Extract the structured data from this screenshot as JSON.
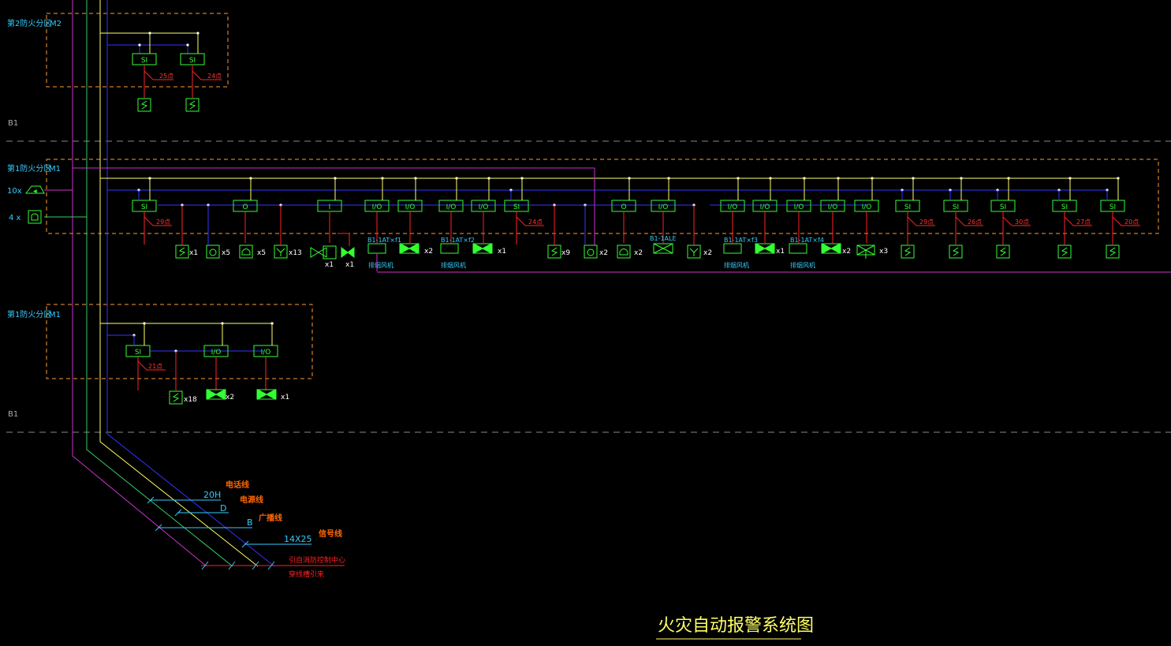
{
  "title": "火灾自动报警系统图",
  "colors": {
    "background": "#000000",
    "signal_line": "#3333ff",
    "power_line": "#ffff66",
    "broadcast_line": "#33cc66",
    "telephone_line": "#cc33cc",
    "module_box": "#33ff33",
    "zone_border": "#ff9933",
    "floor_divider": "#888888",
    "label_text": "#33ccff",
    "cable_label": "#ff6600",
    "note_text": "#ff2222",
    "tap_text": "#ff3333"
  },
  "floors": {
    "upper_label": "B1",
    "lower_label": "B1"
  },
  "zones": [
    {
      "name": "第2防火分区",
      "code": "M2"
    },
    {
      "name": "第1防火分区",
      "code": "M1"
    },
    {
      "name": "第1防火分区",
      "code": "M1"
    }
  ],
  "side_devices": [
    {
      "label": "10x",
      "icon": "horn-strobe-icon"
    },
    {
      "label": "4 x",
      "icon": "telephone-jack-icon"
    }
  ],
  "zone_m2": {
    "modules": [
      {
        "text": "SI",
        "tap": "25点"
      },
      {
        "text": "SI",
        "tap": "24点"
      }
    ]
  },
  "zone_m1_main": {
    "modules": [
      {
        "text": "SI",
        "tap": "29点"
      },
      {
        "text": "O"
      },
      {
        "text": "I"
      },
      {
        "text": "I/O"
      },
      {
        "text": "I/O"
      },
      {
        "text": "I/O"
      },
      {
        "text": "I/O"
      },
      {
        "text": "SI",
        "tap": "24点"
      },
      {
        "text": "O"
      },
      {
        "text": "I/O"
      },
      {
        "text": "I/O"
      },
      {
        "text": "I/O"
      },
      {
        "text": "I/O"
      },
      {
        "text": "I/O"
      },
      {
        "text": "I/O"
      },
      {
        "text": "SI",
        "tap": "29点"
      },
      {
        "text": "SI",
        "tap": "26点"
      },
      {
        "text": "SI",
        "tap": "30点"
      },
      {
        "text": "SI",
        "tap": "27点"
      },
      {
        "text": "SI",
        "tap": "20点"
      }
    ],
    "device_counts": [
      "x1",
      "x5",
      "x5",
      "x13",
      "x1",
      "x1",
      "x2",
      "x1",
      "x9",
      "x2",
      "x2",
      "x2",
      "x1",
      "x2",
      "x3"
    ],
    "equipment_tags": [
      "B1-1AT×f1",
      "B1-1AT×f2",
      "B1-1ALE",
      "B1-1AT×f3",
      "B1-1AT×f4"
    ],
    "equipment_notes": [
      "排烟风机",
      "排烟风机",
      "排烟风机",
      "排烟风机"
    ]
  },
  "zone_m1_lower": {
    "modules": [
      {
        "text": "SI",
        "tap": "21点"
      },
      {
        "text": "I/O"
      },
      {
        "text": "I/O"
      }
    ],
    "device_counts": [
      "x18",
      "x2",
      "x1"
    ]
  },
  "cables": [
    {
      "code": "20H",
      "name": "电话线"
    },
    {
      "code": "D",
      "name": "电源线"
    },
    {
      "code": "B",
      "name": "广播线"
    },
    {
      "code": "14X25",
      "name": "信号线"
    }
  ],
  "note": {
    "line1": "引自消防控制中心",
    "line2": "穿线槽引来"
  }
}
